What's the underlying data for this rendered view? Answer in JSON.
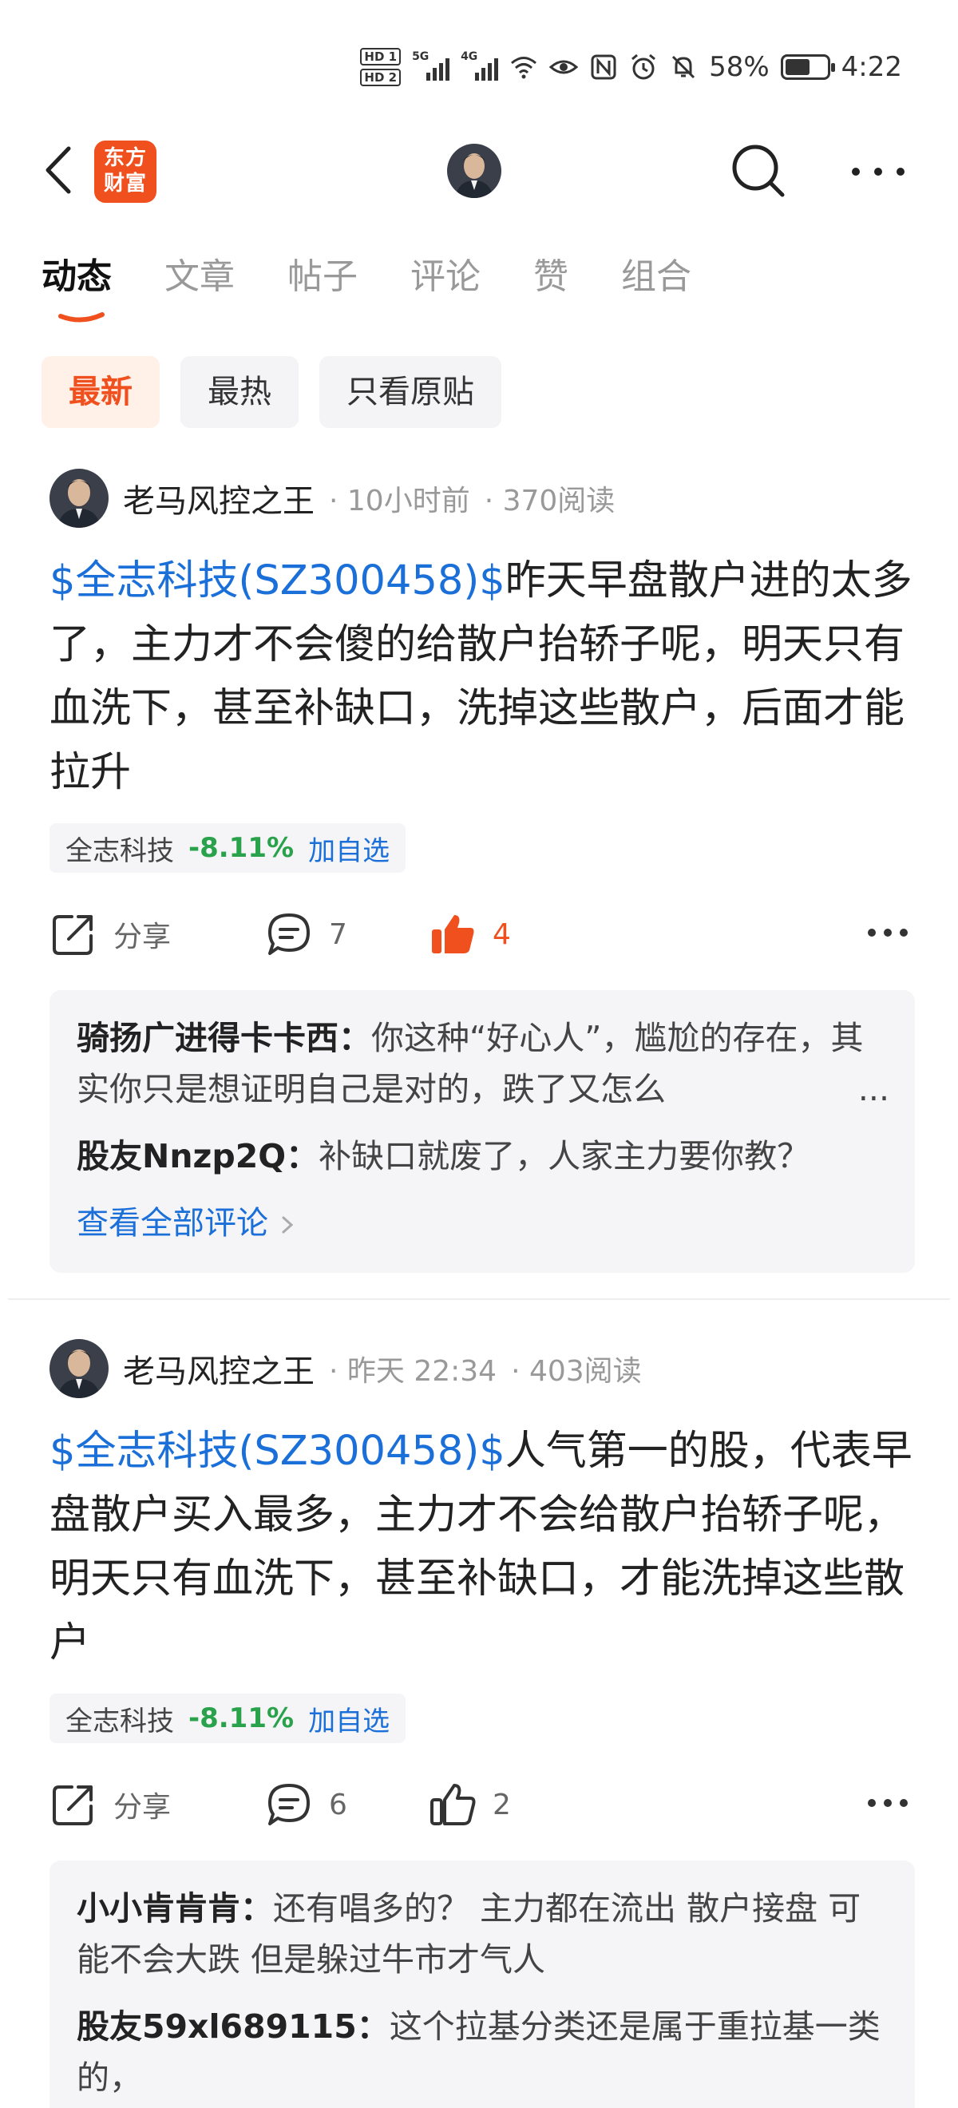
{
  "status_bar": {
    "hd1": "HD 1",
    "hd2": "HD 2",
    "sig1_label": "5G",
    "sig2_label": "4G",
    "battery": "58%",
    "time": "4:22",
    "icons": [
      "wifi-icon",
      "eye-icon",
      "nfc-icon",
      "alarm-icon",
      "mute-icon",
      "battery-icon"
    ]
  },
  "header": {
    "logo_line1": "东方",
    "logo_line2": "财富",
    "icons": [
      "back-icon",
      "avatar",
      "search-icon",
      "more-icon"
    ]
  },
  "tabs": [
    {
      "label": "动态",
      "active": true
    },
    {
      "label": "文章"
    },
    {
      "label": "帖子"
    },
    {
      "label": "评论"
    },
    {
      "label": "赞"
    },
    {
      "label": "组合"
    }
  ],
  "filters": [
    {
      "label": "最新",
      "active": true
    },
    {
      "label": "最热"
    },
    {
      "label": "只看原贴"
    }
  ],
  "posts": [
    {
      "author": "老马风控之王",
      "time": "· 10小时前",
      "reads": "· 370阅读",
      "stock_link": "$全志科技(SZ300458)$",
      "text": "昨天早盘散户进的太多了，主力才不会傻的给散户抬轿子呢，明天只有血洗下，甚至补缺口，洗掉这些散户，后面才能拉升",
      "stock_name": "全志科技",
      "stock_change": "-8.11%",
      "add_watch": "加自选",
      "share_label": "分享",
      "comment_count": "7",
      "like_count": "4",
      "liked": true,
      "comments": [
        {
          "user": "骑扬广进得卡卡西：",
          "text": "你这种“好心人”，尴尬的存在，其实你只是想证明自己是对的，跌了又怎么",
          "ellipsis": "..."
        },
        {
          "user": "股友Nnzp2Q：",
          "text": "补缺口就废了，人家主力要你教？"
        }
      ],
      "view_all": "查看全部评论"
    },
    {
      "author": "老马风控之王",
      "time": "· 昨天 22:34",
      "reads": "· 403阅读",
      "stock_link": "$全志科技(SZ300458)$",
      "text": "人气第一的股，代表早盘散户买入最多，主力才不会给散户抬轿子呢，明天只有血洗下，甚至补缺口，才能洗掉这些散户",
      "stock_name": "全志科技",
      "stock_change": "-8.11%",
      "add_watch": "加自选",
      "share_label": "分享",
      "comment_count": "6",
      "like_count": "2",
      "liked": false,
      "comments": [
        {
          "user": "小小肯肯肯：",
          "text": "还有唱多的？ 主力都在流出 散户接盘 可能不会大跌 但是躲过牛市才气人"
        },
        {
          "user": "股友59xl689115：",
          "text": "这个拉基分类还是属于重拉基一类的，"
        }
      ]
    }
  ],
  "colors": {
    "brand": "#f0501e",
    "link": "#1b6fd8",
    "down": "#2aa14b"
  }
}
